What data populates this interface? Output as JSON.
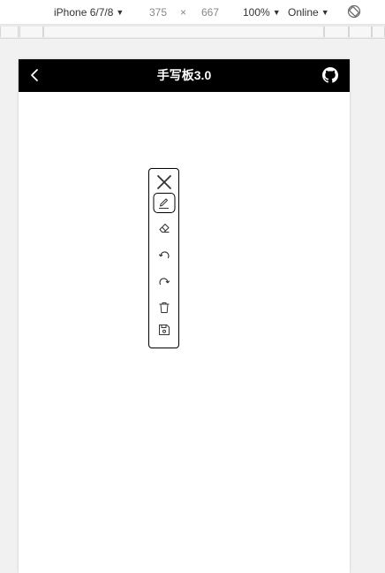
{
  "devtools": {
    "device": "iPhone 6/7/8",
    "width": "375",
    "times": "×",
    "height": "667",
    "zoom": "100%",
    "network": "Online",
    "caret": "▼"
  },
  "app": {
    "title": "手写板3.0",
    "header_bg": "#000000"
  },
  "toolbar": {
    "tools": [
      "close-icon",
      "pen-icon",
      "eraser-icon",
      "undo-icon",
      "redo-icon",
      "trash-icon",
      "save-icon"
    ],
    "active": "pen-icon"
  }
}
